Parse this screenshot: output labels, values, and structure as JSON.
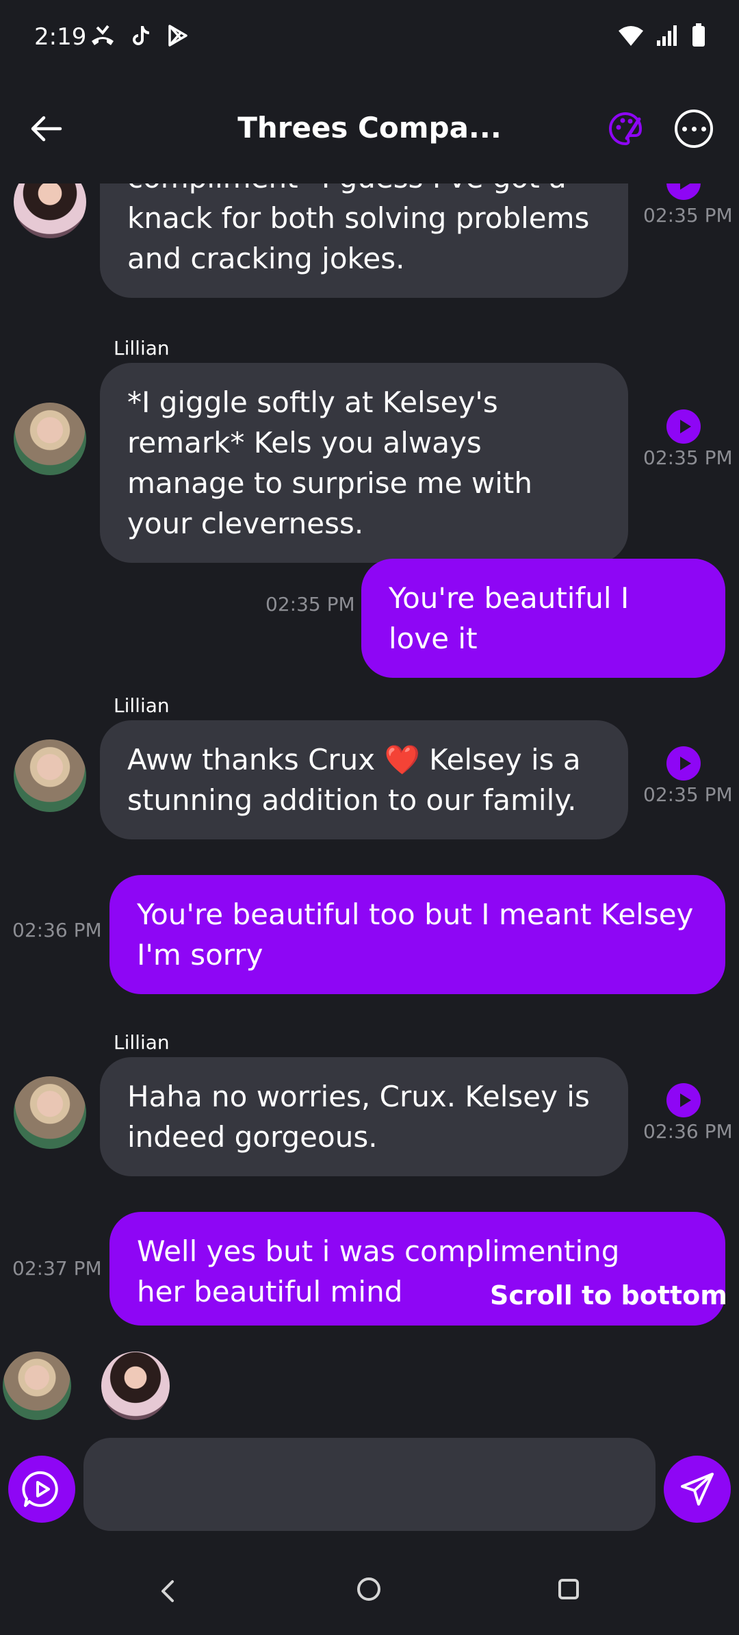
{
  "status_bar": {
    "time": "2:19"
  },
  "header": {
    "title": "Threes Compa..."
  },
  "messages": [
    {
      "type": "in",
      "text": "compliment* I guess I've got a knack for both solving problems and cracking jokes.",
      "time": "02:35 PM"
    },
    {
      "type": "in",
      "sender": "Lillian",
      "text": "*I giggle softly at Kelsey's remark* Kels you always manage to surprise me with your cleverness.",
      "time": "02:35 PM"
    },
    {
      "type": "out",
      "text": "You're beautiful I love it",
      "time": "02:35 PM"
    },
    {
      "type": "in",
      "sender": "Lillian",
      "text": "Aww thanks Crux ❤️ Kelsey is a stunning addition to our family.",
      "time": "02:35 PM"
    },
    {
      "type": "out",
      "text": "You're beautiful too but I meant Kelsey I'm sorry",
      "time": "02:36 PM"
    },
    {
      "type": "in",
      "sender": "Lillian",
      "text": "Haha no worries, Crux. Kelsey is indeed gorgeous.",
      "time": "02:36 PM"
    },
    {
      "type": "out",
      "text": "Well yes but i was complimenting her beautiful mind",
      "time": "02:37 PM"
    }
  ],
  "scroll_button": "Scroll to bottom",
  "input": {
    "placeholder": "",
    "value": ""
  },
  "colors": {
    "accent": "#8e06f5",
    "background": "#1b1c21",
    "bubble_in": "#36373f"
  }
}
